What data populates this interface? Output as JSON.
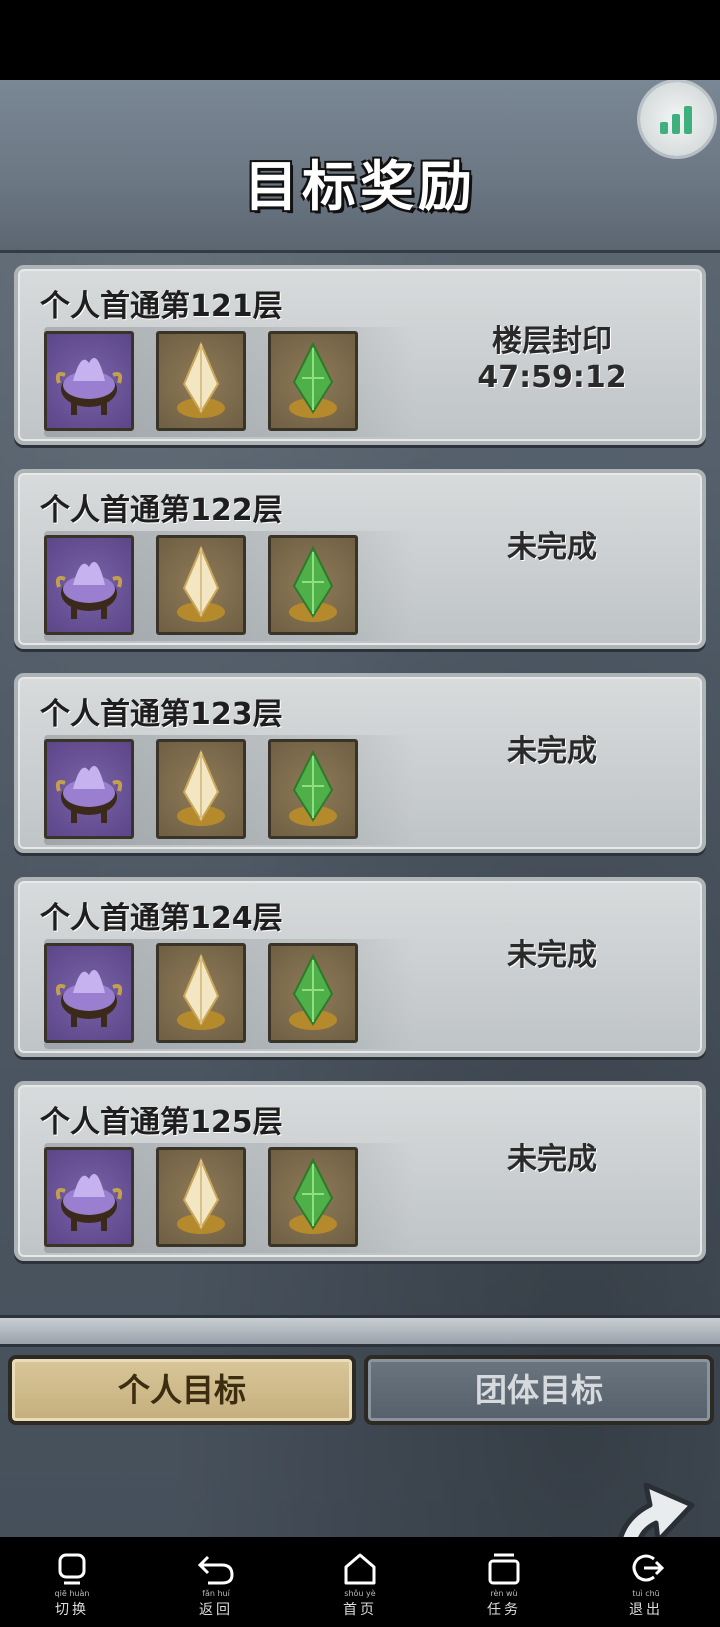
{
  "header": {
    "title": "目标奖励",
    "signal_icon": "signal-bars-icon"
  },
  "rewards": [
    {
      "name": "个人首通第121层",
      "status_line1": "楼层封印",
      "status_line2": "47:59:12"
    },
    {
      "name": "个人首通第122层",
      "status_line1": "未完成",
      "status_line2": ""
    },
    {
      "name": "个人首通第123层",
      "status_line1": "未完成",
      "status_line2": ""
    },
    {
      "name": "个人首通第124层",
      "status_line1": "未完成",
      "status_line2": ""
    },
    {
      "name": "个人首通第125层",
      "status_line1": "未完成",
      "status_line2": ""
    }
  ],
  "reward_items": [
    "purple-cauldron-icon",
    "gold-crystal-icon",
    "green-crystal-icon"
  ],
  "tabs": {
    "personal": "个人目标",
    "team": "团体目标",
    "active": "personal"
  },
  "navbar": {
    "items": [
      {
        "pinyin": "qiē huàn",
        "label": "切换"
      },
      {
        "pinyin": "fǎn huí",
        "label": "返回"
      },
      {
        "pinyin": "shǒu yè",
        "label": "首页"
      },
      {
        "pinyin": "rèn wù",
        "label": "任务"
      },
      {
        "pinyin": "tuì chū",
        "label": "退出"
      }
    ]
  },
  "colors": {
    "accent_gold": "#c4ae7c",
    "signal_green": "#3fb07d",
    "slot_purple": "#5b4688"
  }
}
